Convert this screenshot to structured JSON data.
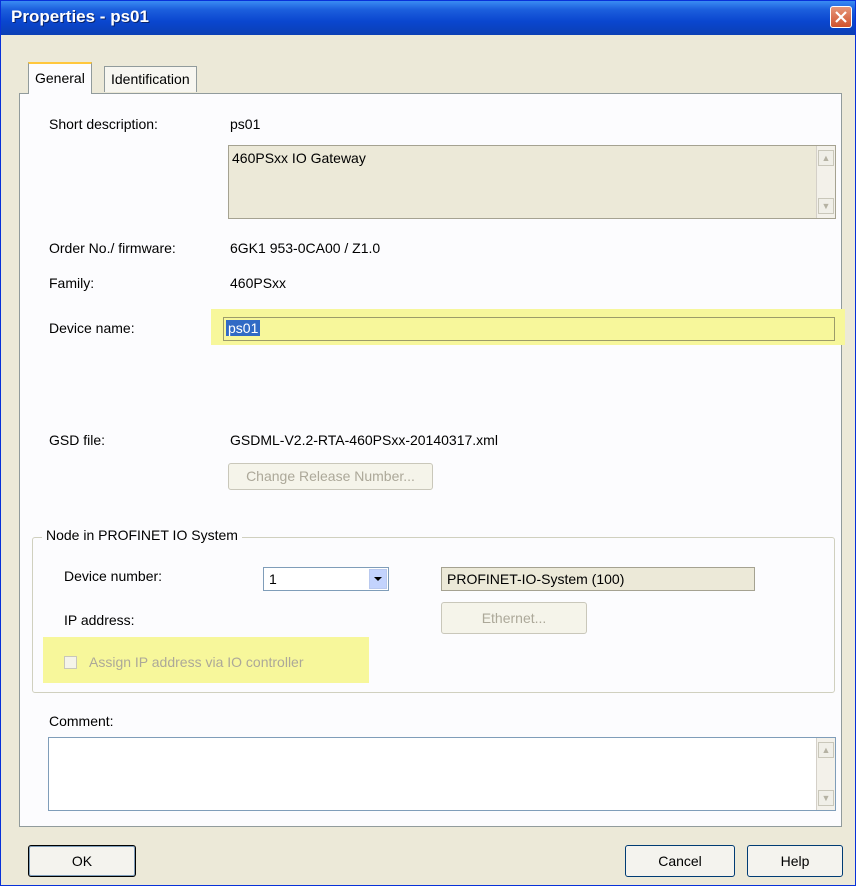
{
  "window": {
    "title": "Properties - ps01"
  },
  "tabs": [
    {
      "label": "General",
      "active": true
    },
    {
      "label": "Identification",
      "active": false
    }
  ],
  "general": {
    "short_description_label": "Short description:",
    "short_description_value": "ps01",
    "description_text": "460PSxx IO Gateway",
    "order_label": "Order No./ firmware:",
    "order_value": "6GK1 953-0CA00 / Z1.0",
    "family_label": "Family:",
    "family_value": "460PSxx",
    "device_name_label": "Device name:",
    "device_name_value": "ps01",
    "gsd_label": "GSD file:",
    "gsd_value": "GSDML-V2.2-RTA-460PSxx-20140317.xml",
    "change_release_button": "Change Release Number...",
    "node_group_title": "Node in PROFINET IO System",
    "device_number_label": "Device number:",
    "device_number_value": "1",
    "io_system_value": "PROFINET-IO-System (100)",
    "ip_address_label": "IP address:",
    "ethernet_button": "Ethernet...",
    "assign_ip_label": "Assign IP address via IO controller",
    "comment_label": "Comment:",
    "comment_value": ""
  },
  "buttons": {
    "ok": "OK",
    "cancel": "Cancel",
    "help": "Help"
  },
  "highlight_color": "#F7F79B"
}
